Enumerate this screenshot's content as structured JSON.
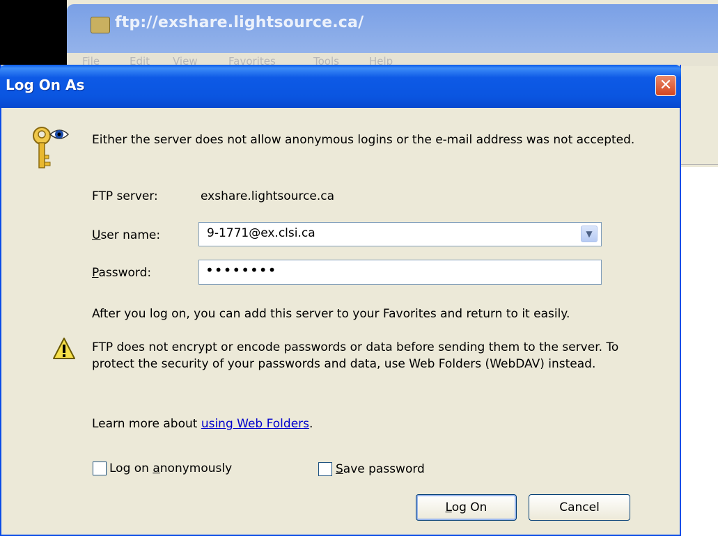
{
  "background_window": {
    "title": "ftp://exshare.lightsource.ca/",
    "menu": [
      "File",
      "Edit",
      "View",
      "Favorites",
      "Tools",
      "Help"
    ]
  },
  "dialog": {
    "title": "Log On As",
    "close_glyph": "✕",
    "message": "Either the server does not allow anonymous logins or the e-mail address was not accepted.",
    "ftp_server_label": "FTP server:",
    "ftp_server_value": "exshare.lightsource.ca",
    "username_label_accel": "U",
    "username_label_rest": "ser name:",
    "username_value": "9-1771@ex.clsi.ca",
    "password_label_accel": "P",
    "password_label_rest": "assword:",
    "password_mask": "••••••••",
    "favorites_note": "After you log on, you can add this server to your Favorites and return to it easily.",
    "warning_text": "FTP does not encrypt or encode passwords or data before sending them to the server.  To protect the security of your passwords and data, use Web Folders (WebDAV) instead.",
    "learn_more_prefix": "Learn more about ",
    "learn_more_link": "using Web Folders",
    "learn_more_suffix": ".",
    "anon_label_pre": "Log on ",
    "anon_label_accel": "a",
    "anon_label_post": "nonymously",
    "save_label_accel": "S",
    "save_label_post": "ave password",
    "logon_accel": "L",
    "logon_rest": "og On",
    "cancel_label": "Cancel"
  },
  "icons": {
    "key": "key-icon",
    "warning": "warning-icon",
    "combo_arrow": "chevron-down-icon"
  }
}
